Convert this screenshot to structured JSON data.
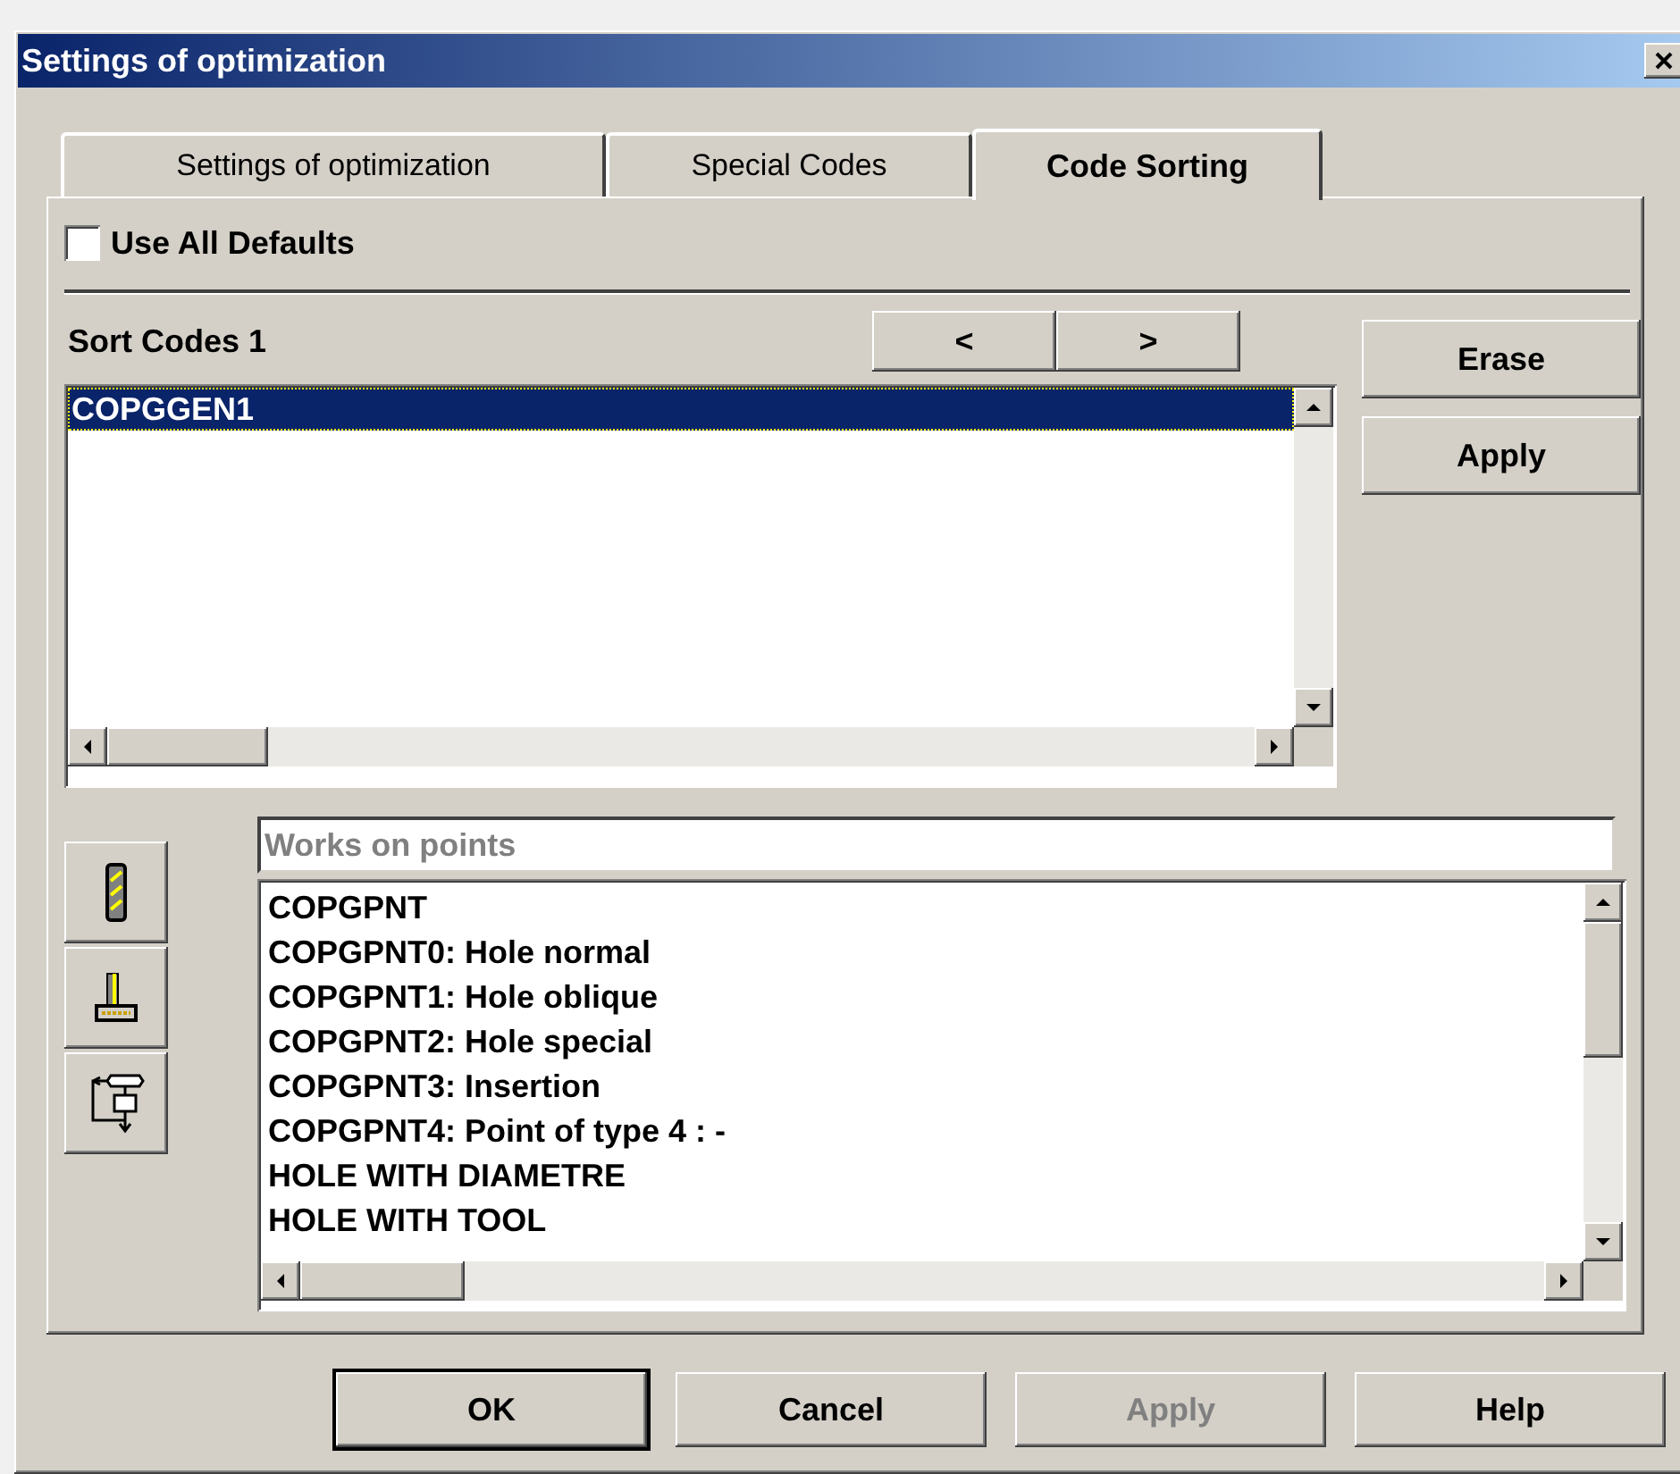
{
  "window": {
    "title": "Settings of optimization"
  },
  "tabs": [
    {
      "label": "Settings of optimization",
      "selected": false
    },
    {
      "label": "Special Codes",
      "selected": false
    },
    {
      "label": "Code Sorting",
      "selected": true
    }
  ],
  "use_all_defaults": {
    "label": "Use All Defaults",
    "checked": false
  },
  "sort_codes": {
    "label": "Sort Codes 1",
    "nav_buttons": [
      "<",
      ">"
    ],
    "items": [
      {
        "label": "COPGGEN1",
        "selected": true
      }
    ]
  },
  "side_buttons": [
    "Erase",
    "Apply"
  ],
  "filter_field": {
    "placeholder": "Works on points"
  },
  "codes": [
    "COPGPNT",
    "COPGPNT0: Hole normal",
    "COPGPNT1: Hole oblique",
    "COPGPNT2: Hole special",
    "COPGPNT3: Insertion",
    "COPGPNT4: Point of type 4 : -",
    "HOLE WITH DIAMETRE",
    "HOLE WITH TOOL"
  ],
  "dialog_buttons": [
    {
      "label": "OK",
      "disabled": false,
      "default": true
    },
    {
      "label": "Cancel",
      "disabled": false,
      "default": false
    },
    {
      "label": "Apply",
      "disabled": true,
      "default": false
    },
    {
      "label": "Help",
      "disabled": false,
      "default": false
    }
  ]
}
